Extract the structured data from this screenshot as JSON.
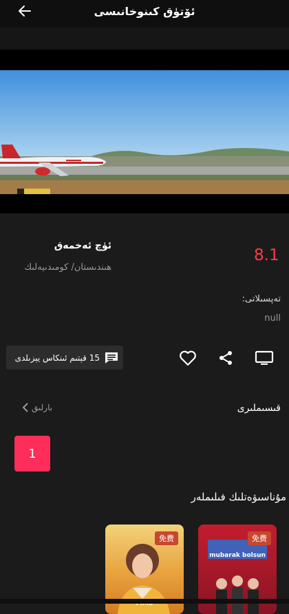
{
  "header": {
    "title": "ئۆتۈق كىنوخانىسى",
    "back_icon": "arrow-left-icon"
  },
  "movie": {
    "name": "ئۈچ ئەخمەق",
    "genre": "ھىندىستان/ كومىدىيەلىك",
    "score": "8.1",
    "description_label": "تەپسىلاتى:",
    "description_value": "null"
  },
  "actions": {
    "comment_label": "15 قېتىم ئىنكاس يېزىلدى",
    "comment_icon": "comment-icon",
    "favorite_icon": "heart-icon",
    "share_icon": "share-icon",
    "tv_icon": "tv-icon"
  },
  "episodes": {
    "title": "قىسىملىرى",
    "all_label": "بارلىق",
    "items": [
      "1"
    ]
  },
  "related": {
    "title": "مۇناسىۋەتلىك فىلىملەر",
    "cards": [
      {
        "badge": "免费",
        "caption": "FIMS"
      },
      {
        "badge": "免费",
        "caption": "mubarak bolsun"
      }
    ]
  },
  "colors": {
    "accent": "#ff2d5a",
    "score": "#ff3a43",
    "background": "#1b1b1b"
  }
}
